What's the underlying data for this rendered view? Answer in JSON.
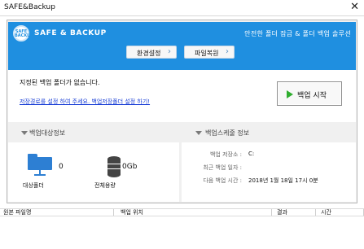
{
  "window": {
    "title": "SAFE&Backup",
    "close_glyph": "✕"
  },
  "banner": {
    "logo_text_top": "SAFE",
    "logo_text_bottom": "BACKUP",
    "brand": "SAFE & BACKUP",
    "slogan": "안전한 폴더 잠금 & 폴더 백업 솔루션",
    "buttons": [
      {
        "label": "환경설정",
        "arrow": "›"
      },
      {
        "label": "파일복원",
        "arrow": "›"
      }
    ],
    "accent_color": "#1f8fe0"
  },
  "message": {
    "line1": "지정된 백업 폴더가 없습니다.",
    "link": "저장경로를 설정 하여 주세요. 백업저장폴더 설정 하기!",
    "start_button": "백업 시작"
  },
  "backup_target": {
    "header": "백업대상정보",
    "folder_count": "0",
    "folder_label": "대상폴더",
    "size": "0Gb",
    "size_label": "전체용량"
  },
  "schedule": {
    "header": "백업스케줄 정보",
    "rows": [
      {
        "key": "백업 저장소 :",
        "value": "C:"
      },
      {
        "key": "최근 백업 일자 :",
        "value": ""
      },
      {
        "key": "다음 백업 시간 :",
        "value": "2018년 1월 18일 17시 0분"
      }
    ]
  },
  "log_table": {
    "columns": [
      "원본 파일명",
      "백업 위치",
      "결과",
      "시간"
    ]
  }
}
